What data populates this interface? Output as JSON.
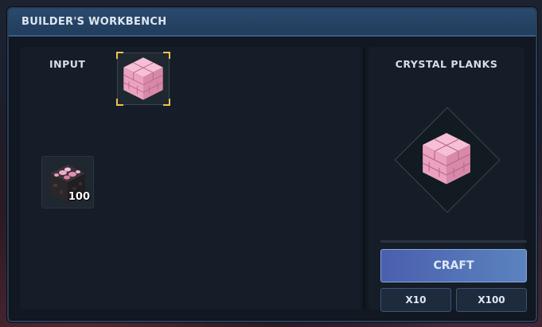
{
  "window": {
    "title": "BUILDER'S WORKBENCH"
  },
  "input": {
    "label": "INPUT",
    "selected_recipe": {
      "item": "crystal-planks",
      "icon": "pink-planks-block-icon"
    },
    "slots": [
      {
        "item": "crystal-ore",
        "icon": "dark-stone-pink-crystal-block-icon",
        "quantity": "100"
      }
    ]
  },
  "output": {
    "title": "CRYSTAL PLANKS",
    "icon": "pink-planks-block-icon",
    "craft_progress": 0,
    "craft_label": "CRAFT",
    "multiplier_buttons": [
      "X10",
      "X100"
    ]
  },
  "colors": {
    "accent_corner": "#f0c24a",
    "craft_button_start": "#4a5fae",
    "craft_button_end": "#5b83bf",
    "titlebar": "#2a4a6e",
    "plank_pink": "#f0a9c6"
  }
}
